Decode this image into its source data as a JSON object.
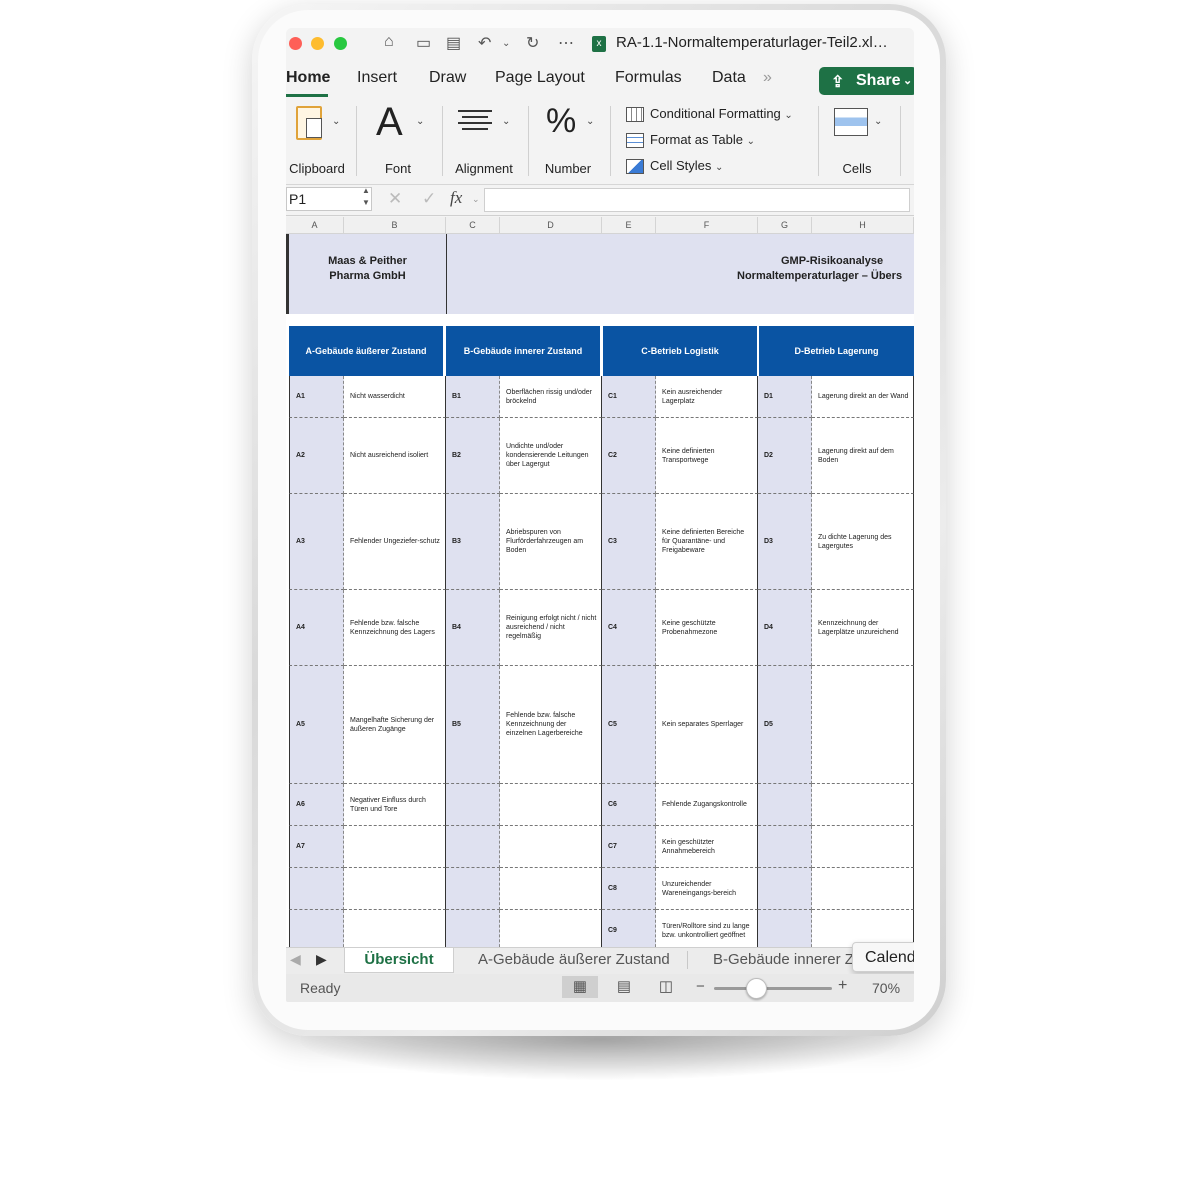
{
  "window": {
    "title": "RA-1.1-Normaltemperaturlager-Teil2.xl…",
    "traffic_light_colors": [
      "#fe5f57",
      "#febc2e",
      "#28c840"
    ]
  },
  "tabs": {
    "items": [
      "Home",
      "Insert",
      "Draw",
      "Page Layout",
      "Formulas",
      "Data"
    ],
    "overflow_icon": "»",
    "share_label": "Share",
    "accent": "#1e7145"
  },
  "ribbon": {
    "clipboard": "Clipboard",
    "font": "Font",
    "alignment": "Alignment",
    "number": "Number",
    "conditional_formatting": "Conditional Formatting",
    "format_as_table": "Format as Table",
    "cell_styles": "Cell Styles",
    "cells": "Cells"
  },
  "formula_bar": {
    "name_box": "P1",
    "fx": "fx",
    "value": ""
  },
  "columns": [
    "A",
    "B",
    "C",
    "D",
    "E",
    "F",
    "G",
    "H"
  ],
  "sheet": {
    "company_line1": "Maas & Peither",
    "company_line2": "Pharma GmbH",
    "title_line1": "GMP-Risikoanalyse",
    "title_line2": "Normaltemperaturlager – Übers",
    "header_color": "#0a54a3",
    "category_a": "A-Gebäude äußerer Zustand",
    "category_b": "B-Gebäude innerer Zustand",
    "category_c": "C-Betrieb Logistik",
    "category_d": "D-Betrieb Lagerung",
    "rows": [
      {
        "a_code": "A1",
        "a_text": "Nicht wasserdicht",
        "b_code": "B1",
        "b_text": "Oberflächen rissig und/oder bröckelnd",
        "c_code": "C1",
        "c_text": "Kein ausreichender Lagerplatz",
        "d_code": "D1",
        "d_text": "Lagerung direkt an der Wand"
      },
      {
        "a_code": "A2",
        "a_text": "Nicht ausreichend isoliert",
        "b_code": "B2",
        "b_text": "Undichte und/oder kondensierende Leitungen über Lagergut",
        "c_code": "C2",
        "c_text": "Keine definierten Transportwege",
        "d_code": "D2",
        "d_text": "Lagerung direkt auf dem Boden"
      },
      {
        "a_code": "A3",
        "a_text": "Fehlender Ungeziefer-schutz",
        "b_code": "B3",
        "b_text": "Abriebspuren von Flurförderfahrzeugen am Boden",
        "c_code": "C3",
        "c_text": "Keine definierten Bereiche für Quarantäne- und Freigabeware",
        "d_code": "D3",
        "d_text": "Zu dichte Lagerung des Lagergutes"
      },
      {
        "a_code": "A4",
        "a_text": "Fehlende bzw. falsche Kennzeichnung des Lagers",
        "b_code": "B4",
        "b_text": "Reinigung erfolgt nicht / nicht ausreichend / nicht regelmäßig",
        "c_code": "C4",
        "c_text": "Keine geschützte Probenahmezone",
        "d_code": "D4",
        "d_text": "Kennzeichnung der Lagerplätze unzureichend"
      },
      {
        "a_code": "A5",
        "a_text": "Mangelhafte Sicherung der äußeren Zugänge",
        "b_code": "B5",
        "b_text": "Fehlende bzw. falsche Kennzeichnung der einzelnen Lagerbereiche",
        "c_code": "C5",
        "c_text": "Kein separates Sperrlager",
        "d_code": "D5",
        "d_text": ""
      },
      {
        "a_code": "A6",
        "a_text": "Negativer Einfluss durch Türen und Tore",
        "b_code": "",
        "b_text": "",
        "c_code": "C6",
        "c_text": "Fehlende Zugangskontrolle",
        "d_code": "",
        "d_text": ""
      },
      {
        "a_code": "A7",
        "a_text": "",
        "b_code": "",
        "b_text": "",
        "c_code": "C7",
        "c_text": "Kein geschützter Annahmebereich",
        "d_code": "",
        "d_text": ""
      },
      {
        "a_code": "",
        "a_text": "",
        "b_code": "",
        "b_text": "",
        "c_code": "C8",
        "c_text": "Unzureichender Wareneingangs-bereich",
        "d_code": "",
        "d_text": ""
      },
      {
        "a_code": "",
        "a_text": "",
        "b_code": "",
        "b_text": "",
        "c_code": "C9",
        "c_text": "Türen/Rolltore sind zu lange bzw. unkontrolliert geöffnet",
        "d_code": "",
        "d_text": ""
      }
    ]
  },
  "sheet_tabs": [
    "Übersicht",
    "A-Gebäude äußerer Zustand",
    "B-Gebäude innerer Z"
  ],
  "calendar_popup": "Calendar",
  "status": {
    "ready": "Ready",
    "zoom": "70%"
  }
}
